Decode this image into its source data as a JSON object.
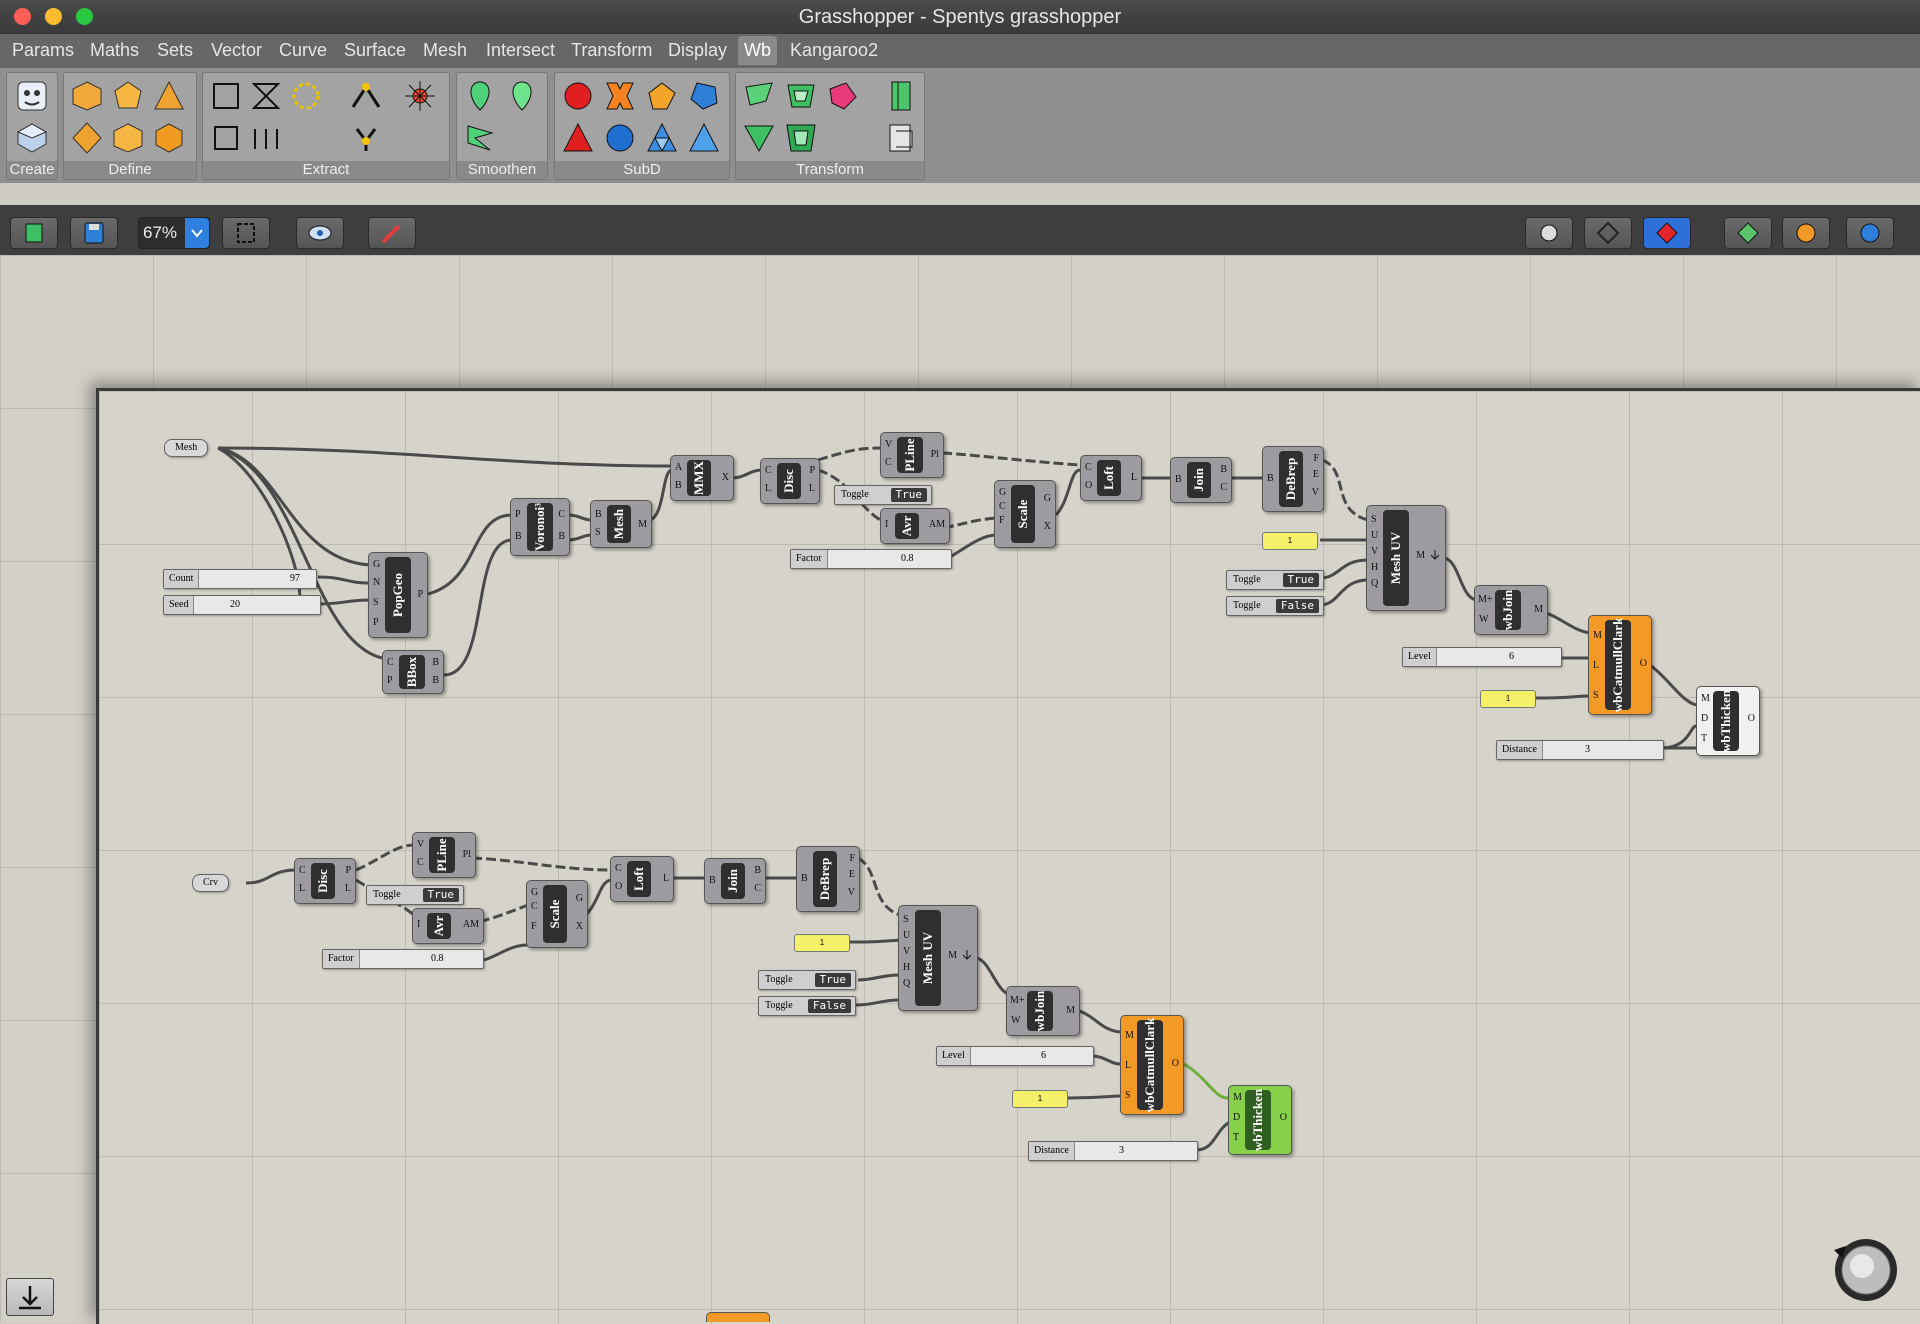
{
  "window": {
    "title": "Grasshopper - Spentys grasshopper"
  },
  "menu": {
    "tabs": [
      "Params",
      "Maths",
      "Sets",
      "Vector",
      "Curve",
      "Surface",
      "Mesh",
      "Intersect",
      "Transform",
      "Display",
      "Wb",
      "Kangaroo2"
    ],
    "active": "Wb"
  },
  "ribbon": {
    "groups": [
      "Create",
      "Define",
      "Extract",
      "Smoothen",
      "SubD",
      "Transform"
    ]
  },
  "toolbar": {
    "zoom": "67%"
  },
  "colors": {
    "accent_orange": "#f39a26",
    "accent_green": "#86d04a",
    "panel_yellow": "#f5f06a"
  },
  "graph1": {
    "mesh": "Mesh",
    "count_label": "Count",
    "count_value": "97",
    "seed_label": "Seed",
    "seed_value": "20",
    "popgeo": "PopGeo",
    "bbox": "BBox",
    "voronoi": "Voronoi³",
    "mesh_node": "Mesh",
    "mmx": "MMX",
    "disc": "Disc",
    "pline": "PLine",
    "toggle_label": "Toggle",
    "toggle_value": "True",
    "avr": "Avr",
    "factor_label": "Factor",
    "factor_value": "0.8",
    "scale": "Scale",
    "loft": "Loft",
    "join": "Join",
    "debrep": "DeBrep",
    "panel1": "1",
    "meshuv": "Mesh UV",
    "toggle2_value": "True",
    "toggle3_value": "False",
    "wbjoin": "wbJoin",
    "level_label": "Level",
    "level_value": "6",
    "panel2": "1",
    "catmull": "wbCatmullClark",
    "distance_label": "Distance",
    "distance_value": "3",
    "thicken": "wbThicken"
  },
  "graph2": {
    "crv": "Crv",
    "disc": "Disc",
    "pline": "PLine",
    "toggle_label": "Toggle",
    "toggle_value": "True",
    "avr": "Avr",
    "factor_label": "Factor",
    "factor_value": "0.8",
    "scale": "Scale",
    "loft": "Loft",
    "join": "Join",
    "debrep": "DeBrep",
    "panel1": "1",
    "meshuv": "Mesh UV",
    "toggle2_value": "True",
    "toggle3_value": "False",
    "wbjoin": "wbJoin",
    "level_label": "Level",
    "level_value": "6",
    "panel2": "1",
    "catmull": "wbCatmullClark",
    "distance_label": "Distance",
    "distance_value": "3",
    "thicken": "wbThicken"
  }
}
